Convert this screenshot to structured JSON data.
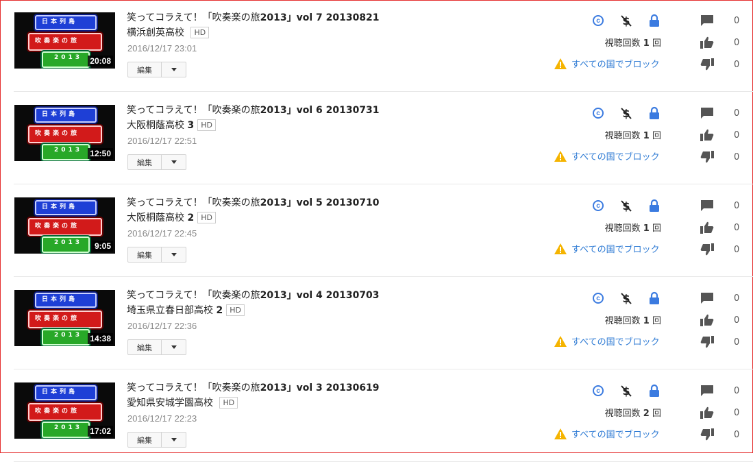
{
  "hd_label": "HD",
  "edit_label": "編集",
  "views_prefix": "視聴回数",
  "views_suffix": "回",
  "block_text": "すべての国でブロック",
  "thumb_text": {
    "line1": "日本列島",
    "line2": "吹奏楽の旅",
    "line3": "2013"
  },
  "colors": {
    "accent_blue": "#3b7be0",
    "link_blue": "#2f7bd4",
    "warning_yellow": "#f5b400",
    "frame_red": "#e52d2d"
  },
  "icons": [
    "copyright-icon",
    "no-monetization-icon",
    "lock-icon",
    "warning-icon",
    "comment-icon",
    "thumbs-up-icon",
    "thumbs-down-icon",
    "dropdown-caret-icon"
  ],
  "videos": [
    {
      "title_prefix": "笑ってコラえて！「吹奏楽の旅",
      "title_bold": "2013",
      "title_suffix": "」vol 7 20130821",
      "subtitle": "横浜創英高校",
      "subtitle_num": "",
      "date": "2016/12/17 23:01",
      "duration": "20:08",
      "views": "1",
      "comments": "0",
      "likes": "0",
      "dislikes": "0"
    },
    {
      "title_prefix": "笑ってコラえて！「吹奏楽の旅",
      "title_bold": "2013",
      "title_suffix": "」vol 6 20130731",
      "subtitle": "大阪桐蔭高校",
      "subtitle_num": "3",
      "date": "2016/12/17 22:51",
      "duration": "12:50",
      "views": "1",
      "comments": "0",
      "likes": "0",
      "dislikes": "0"
    },
    {
      "title_prefix": "笑ってコラえて！「吹奏楽の旅",
      "title_bold": "2013",
      "title_suffix": "」vol 5 20130710",
      "subtitle": "大阪桐蔭高校",
      "subtitle_num": "2",
      "date": "2016/12/17 22:45",
      "duration": "9:05",
      "views": "1",
      "comments": "0",
      "likes": "0",
      "dislikes": "0"
    },
    {
      "title_prefix": "笑ってコラえて！「吹奏楽の旅",
      "title_bold": "2013",
      "title_suffix": "」vol 4 20130703",
      "subtitle": "埼玉県立春日部高校",
      "subtitle_num": "2",
      "date": "2016/12/17 22:36",
      "duration": "14:38",
      "views": "1",
      "comments": "0",
      "likes": "0",
      "dislikes": "0"
    },
    {
      "title_prefix": "笑ってコラえて！「吹奏楽の旅",
      "title_bold": "2013",
      "title_suffix": "」vol 3 20130619",
      "subtitle": "愛知県安城学園高校",
      "subtitle_num": "",
      "date": "2016/12/17 22:23",
      "duration": "17:02",
      "views": "2",
      "comments": "0",
      "likes": "0",
      "dislikes": "0"
    }
  ]
}
